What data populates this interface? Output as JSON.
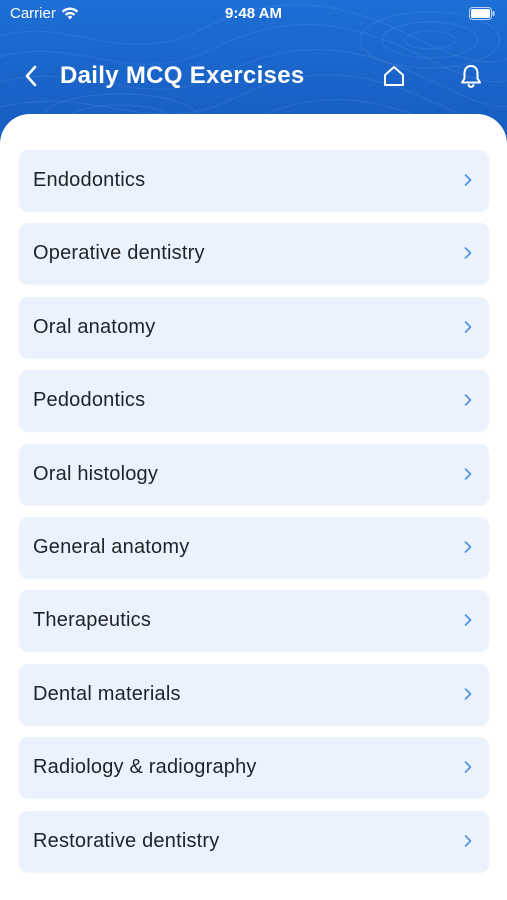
{
  "status_bar": {
    "carrier": "Carrier",
    "time": "9:48 AM"
  },
  "nav": {
    "title": "Daily MCQ Exercises",
    "back_icon": "chevron-left-icon",
    "home_icon": "home-icon",
    "bell_icon": "bell-icon"
  },
  "colors": {
    "header": "#1a63c8",
    "item_bg": "#ebf2fd",
    "chevron": "#4a90e2"
  },
  "categories": [
    {
      "label": "Endodontics"
    },
    {
      "label": "Operative dentistry"
    },
    {
      "label": "Oral anatomy"
    },
    {
      "label": "Pedodontics"
    },
    {
      "label": "Oral histology"
    },
    {
      "label": "General anatomy"
    },
    {
      "label": "Therapeutics"
    },
    {
      "label": "Dental materials"
    },
    {
      "label": "Radiology & radiography"
    },
    {
      "label": "Restorative dentistry"
    }
  ]
}
